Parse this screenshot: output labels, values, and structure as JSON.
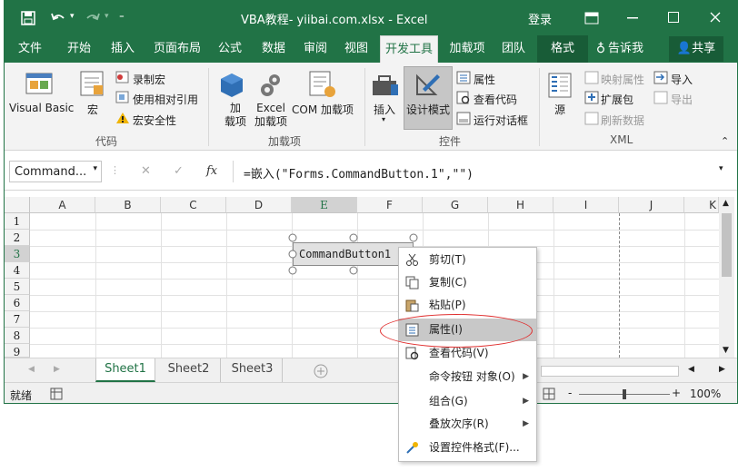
{
  "title_bar": {
    "title": "VBA教程- yiibai.com.xlsx - Excel",
    "login": "登录",
    "minimize_icon": "minimize-icon",
    "maximize_icon": "maximize-icon",
    "close_icon": "close-icon"
  },
  "tabs": [
    {
      "label": "文件"
    },
    {
      "label": "开始"
    },
    {
      "label": "插入"
    },
    {
      "label": "页面布局"
    },
    {
      "label": "公式"
    },
    {
      "label": "数据"
    },
    {
      "label": "审阅"
    },
    {
      "label": "视图"
    },
    {
      "label": "开发工具"
    },
    {
      "label": "加载项"
    },
    {
      "label": "团队"
    },
    {
      "label": "格式"
    },
    {
      "label": "告诉我"
    },
    {
      "label": "共享"
    }
  ],
  "ribbon": {
    "code": {
      "visual_basic": "Visual Basic",
      "macro": "宏",
      "record": "录制宏",
      "relative": "使用相对引用",
      "security": "宏安全性",
      "group": "代码"
    },
    "addins": {
      "add": "加\n载项",
      "excel_addins": "Excel\n加载项",
      "com": "COM 加载项",
      "group": "加载项"
    },
    "controls": {
      "insert": "插入",
      "design": "设计模式",
      "properties": "属性",
      "view_code": "查看代码",
      "run_dialog": "运行对话框",
      "group": "控件"
    },
    "xml": {
      "source": "源",
      "map": "映射属性",
      "expansion": "扩展包",
      "refresh": "刷新数据",
      "import": "导入",
      "export": "导出",
      "group": "XML"
    }
  },
  "formula": {
    "name_box": "Command...",
    "cancel": "✕",
    "enter": "✓",
    "fx": "fx",
    "value": "=嵌入(\"Forms.CommandButton.1\",\"\")"
  },
  "columns": [
    "A",
    "B",
    "C",
    "D",
    "E",
    "F",
    "G",
    "H",
    "I",
    "J",
    "K"
  ],
  "rows": [
    "1",
    "2",
    "3",
    "4",
    "5",
    "6",
    "7",
    "8",
    "9"
  ],
  "button": {
    "caption": "CommandButton1"
  },
  "sheets": [
    "Sheet1",
    "Sheet2",
    "Sheet3"
  ],
  "status": {
    "ready": "就绪",
    "zoom": "100%",
    "zoom_minus": "-",
    "zoom_plus": "+"
  },
  "context_menu": [
    {
      "label": "剪切(T)",
      "icon": "scissors-icon"
    },
    {
      "label": "复制(C)",
      "icon": "copy-icon"
    },
    {
      "label": "粘贴(P)",
      "icon": "paste-icon"
    },
    {
      "label": "属性(I)",
      "icon": "properties-icon"
    },
    {
      "label": "查看代码(V)",
      "icon": "view-code-icon"
    },
    {
      "label": "命令按钮 对象(O)",
      "icon": ""
    },
    {
      "label": "组合(G)",
      "icon": ""
    },
    {
      "label": "叠放次序(R)",
      "icon": ""
    },
    {
      "label": "设置控件格式(F)...",
      "icon": "format-control-icon"
    }
  ],
  "colors": {
    "excel_green": "#217346",
    "selection_ring": "#e03030"
  }
}
